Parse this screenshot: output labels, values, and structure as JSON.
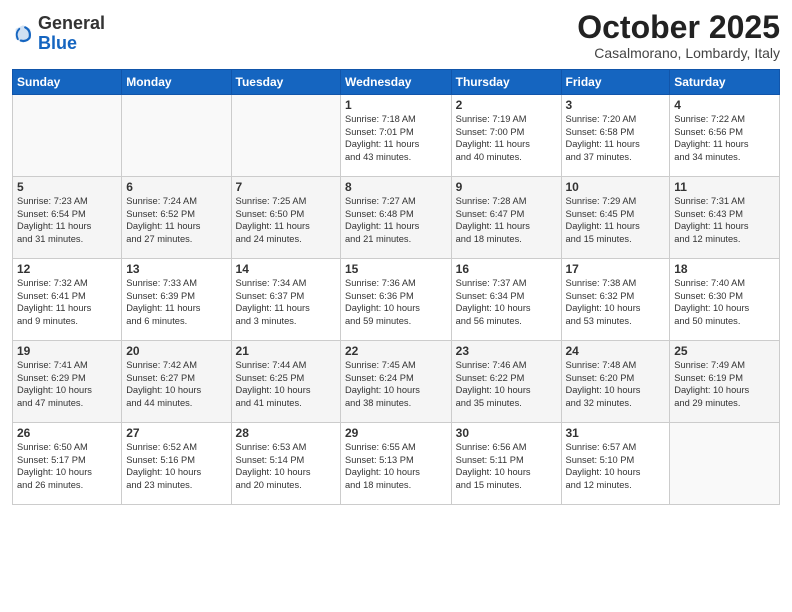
{
  "header": {
    "logo_general": "General",
    "logo_blue": "Blue",
    "month": "October 2025",
    "location": "Casalmorano, Lombardy, Italy"
  },
  "weekdays": [
    "Sunday",
    "Monday",
    "Tuesday",
    "Wednesday",
    "Thursday",
    "Friday",
    "Saturday"
  ],
  "weeks": [
    [
      {
        "day": "",
        "info": ""
      },
      {
        "day": "",
        "info": ""
      },
      {
        "day": "",
        "info": ""
      },
      {
        "day": "1",
        "info": "Sunrise: 7:18 AM\nSunset: 7:01 PM\nDaylight: 11 hours\nand 43 minutes."
      },
      {
        "day": "2",
        "info": "Sunrise: 7:19 AM\nSunset: 7:00 PM\nDaylight: 11 hours\nand 40 minutes."
      },
      {
        "day": "3",
        "info": "Sunrise: 7:20 AM\nSunset: 6:58 PM\nDaylight: 11 hours\nand 37 minutes."
      },
      {
        "day": "4",
        "info": "Sunrise: 7:22 AM\nSunset: 6:56 PM\nDaylight: 11 hours\nand 34 minutes."
      }
    ],
    [
      {
        "day": "5",
        "info": "Sunrise: 7:23 AM\nSunset: 6:54 PM\nDaylight: 11 hours\nand 31 minutes."
      },
      {
        "day": "6",
        "info": "Sunrise: 7:24 AM\nSunset: 6:52 PM\nDaylight: 11 hours\nand 27 minutes."
      },
      {
        "day": "7",
        "info": "Sunrise: 7:25 AM\nSunset: 6:50 PM\nDaylight: 11 hours\nand 24 minutes."
      },
      {
        "day": "8",
        "info": "Sunrise: 7:27 AM\nSunset: 6:48 PM\nDaylight: 11 hours\nand 21 minutes."
      },
      {
        "day": "9",
        "info": "Sunrise: 7:28 AM\nSunset: 6:47 PM\nDaylight: 11 hours\nand 18 minutes."
      },
      {
        "day": "10",
        "info": "Sunrise: 7:29 AM\nSunset: 6:45 PM\nDaylight: 11 hours\nand 15 minutes."
      },
      {
        "day": "11",
        "info": "Sunrise: 7:31 AM\nSunset: 6:43 PM\nDaylight: 11 hours\nand 12 minutes."
      }
    ],
    [
      {
        "day": "12",
        "info": "Sunrise: 7:32 AM\nSunset: 6:41 PM\nDaylight: 11 hours\nand 9 minutes."
      },
      {
        "day": "13",
        "info": "Sunrise: 7:33 AM\nSunset: 6:39 PM\nDaylight: 11 hours\nand 6 minutes."
      },
      {
        "day": "14",
        "info": "Sunrise: 7:34 AM\nSunset: 6:37 PM\nDaylight: 11 hours\nand 3 minutes."
      },
      {
        "day": "15",
        "info": "Sunrise: 7:36 AM\nSunset: 6:36 PM\nDaylight: 10 hours\nand 59 minutes."
      },
      {
        "day": "16",
        "info": "Sunrise: 7:37 AM\nSunset: 6:34 PM\nDaylight: 10 hours\nand 56 minutes."
      },
      {
        "day": "17",
        "info": "Sunrise: 7:38 AM\nSunset: 6:32 PM\nDaylight: 10 hours\nand 53 minutes."
      },
      {
        "day": "18",
        "info": "Sunrise: 7:40 AM\nSunset: 6:30 PM\nDaylight: 10 hours\nand 50 minutes."
      }
    ],
    [
      {
        "day": "19",
        "info": "Sunrise: 7:41 AM\nSunset: 6:29 PM\nDaylight: 10 hours\nand 47 minutes."
      },
      {
        "day": "20",
        "info": "Sunrise: 7:42 AM\nSunset: 6:27 PM\nDaylight: 10 hours\nand 44 minutes."
      },
      {
        "day": "21",
        "info": "Sunrise: 7:44 AM\nSunset: 6:25 PM\nDaylight: 10 hours\nand 41 minutes."
      },
      {
        "day": "22",
        "info": "Sunrise: 7:45 AM\nSunset: 6:24 PM\nDaylight: 10 hours\nand 38 minutes."
      },
      {
        "day": "23",
        "info": "Sunrise: 7:46 AM\nSunset: 6:22 PM\nDaylight: 10 hours\nand 35 minutes."
      },
      {
        "day": "24",
        "info": "Sunrise: 7:48 AM\nSunset: 6:20 PM\nDaylight: 10 hours\nand 32 minutes."
      },
      {
        "day": "25",
        "info": "Sunrise: 7:49 AM\nSunset: 6:19 PM\nDaylight: 10 hours\nand 29 minutes."
      }
    ],
    [
      {
        "day": "26",
        "info": "Sunrise: 6:50 AM\nSunset: 5:17 PM\nDaylight: 10 hours\nand 26 minutes."
      },
      {
        "day": "27",
        "info": "Sunrise: 6:52 AM\nSunset: 5:16 PM\nDaylight: 10 hours\nand 23 minutes."
      },
      {
        "day": "28",
        "info": "Sunrise: 6:53 AM\nSunset: 5:14 PM\nDaylight: 10 hours\nand 20 minutes."
      },
      {
        "day": "29",
        "info": "Sunrise: 6:55 AM\nSunset: 5:13 PM\nDaylight: 10 hours\nand 18 minutes."
      },
      {
        "day": "30",
        "info": "Sunrise: 6:56 AM\nSunset: 5:11 PM\nDaylight: 10 hours\nand 15 minutes."
      },
      {
        "day": "31",
        "info": "Sunrise: 6:57 AM\nSunset: 5:10 PM\nDaylight: 10 hours\nand 12 minutes."
      },
      {
        "day": "",
        "info": ""
      }
    ]
  ]
}
